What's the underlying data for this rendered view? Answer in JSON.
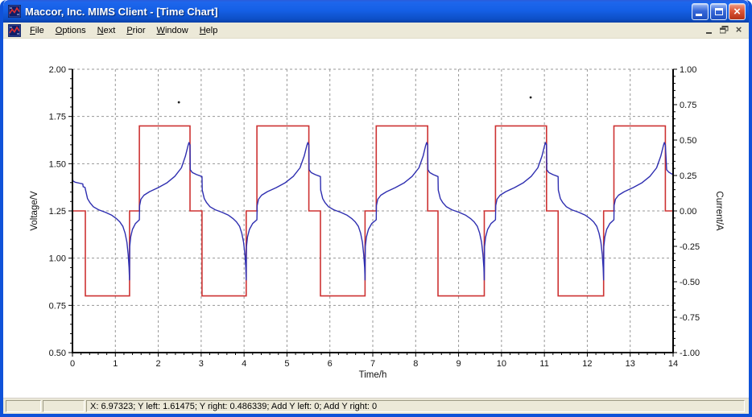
{
  "window": {
    "title": "Maccor, Inc. MIMS Client - [Time Chart]"
  },
  "menu": {
    "items": [
      {
        "label": "File",
        "underline": 0
      },
      {
        "label": "Options",
        "underline": 0
      },
      {
        "label": "Next",
        "underline": 0
      },
      {
        "label": "Prior",
        "underline": 0
      },
      {
        "label": "Window",
        "underline": 0
      },
      {
        "label": "Help",
        "underline": 0
      }
    ]
  },
  "status_bar": {
    "text": "X: 6.97323; Y left: 1.61475; Y right: 0.486339; Add Y left: 0; Add Y right: 0"
  },
  "chart_data": {
    "type": "line",
    "x_axis": {
      "label": "Time/h",
      "min": 0,
      "max": 14,
      "major_step": 1,
      "minor_step": 0.2
    },
    "y_left": {
      "label": "Voltage/V",
      "min": 0.5,
      "max": 2.0,
      "major_step": 0.25,
      "minor_step": 0.05
    },
    "y_right": {
      "label": "Current/A",
      "min": -1.0,
      "max": 1.0,
      "major_step": 0.25,
      "minor_step": 0.05
    },
    "grid": {
      "x_lines": [
        1,
        2,
        3,
        4,
        5,
        6,
        7,
        8,
        9,
        10,
        11,
        12,
        13
      ],
      "y_lines_left": [
        0.75,
        1.0,
        1.25,
        1.5,
        1.75,
        2.0
      ],
      "color": "#979797"
    },
    "series": [
      {
        "name": "Current",
        "axis": "right",
        "color": "#cd3232",
        "style": "step",
        "segments": [
          [
            0,
            0,
            0.6
          ],
          [
            0,
            0.3,
            0
          ],
          [
            0.3,
            1.33,
            -0.6
          ],
          [
            1.33,
            1.56,
            0
          ],
          [
            1.56,
            2.74,
            0.6
          ],
          [
            2.74,
            3.02,
            0
          ],
          [
            3.02,
            4.05,
            -0.6
          ],
          [
            4.05,
            4.3,
            0
          ],
          [
            4.3,
            5.51,
            0.6
          ],
          [
            5.51,
            5.78,
            0
          ],
          [
            5.78,
            6.82,
            -0.6
          ],
          [
            6.82,
            7.08,
            0
          ],
          [
            7.08,
            8.28,
            0.6
          ],
          [
            8.28,
            8.52,
            0
          ],
          [
            8.52,
            9.6,
            -0.6
          ],
          [
            9.6,
            9.86,
            0
          ],
          [
            9.86,
            11.05,
            0.6
          ],
          [
            11.05,
            11.32,
            0
          ],
          [
            11.32,
            12.38,
            -0.6
          ],
          [
            12.38,
            12.62,
            0
          ],
          [
            12.62,
            13.82,
            0.6
          ],
          [
            13.82,
            14,
            0
          ]
        ]
      },
      {
        "name": "Voltage",
        "axis": "left",
        "color": "#2e2eb0",
        "style": "curve",
        "initial_points": [
          [
            0,
            1.435
          ],
          [
            0.01,
            1.41
          ],
          [
            0.06,
            1.402
          ],
          [
            0.16,
            1.397
          ],
          [
            0.24,
            1.393
          ],
          [
            0.25,
            1.378
          ],
          [
            0.29,
            1.375
          ]
        ],
        "cycles": [
          {
            "d0": 0.3,
            "d1": 1.33,
            "c0": 1.56,
            "c1": 2.74
          },
          {
            "d0": 3.02,
            "d1": 4.05,
            "c0": 4.3,
            "c1": 5.51
          },
          {
            "d0": 5.78,
            "d1": 6.82,
            "c0": 7.08,
            "c1": 8.28
          },
          {
            "d0": 8.52,
            "d1": 9.6,
            "c0": 9.86,
            "c1": 11.05
          },
          {
            "d0": 11.32,
            "d1": 12.38,
            "c0": 12.62,
            "c1": 13.82
          }
        ],
        "discharge_shape": [
          [
            0.005,
            1.36
          ],
          [
            0.05,
            1.315
          ],
          [
            0.1,
            1.295
          ],
          [
            0.18,
            1.272
          ],
          [
            0.3,
            1.256
          ],
          [
            0.45,
            1.243
          ],
          [
            0.6,
            1.227
          ],
          [
            0.7,
            1.21
          ],
          [
            0.78,
            1.192
          ],
          [
            0.85,
            1.168
          ],
          [
            0.9,
            1.132
          ],
          [
            0.94,
            1.085
          ],
          [
            0.97,
            1.02
          ],
          [
            0.99,
            0.95
          ],
          [
            1,
            0.885
          ]
        ],
        "rest1_shape": [
          [
            0.02,
            1.06
          ],
          [
            0.12,
            1.112
          ],
          [
            0.3,
            1.152
          ],
          [
            0.6,
            1.183
          ],
          [
            1,
            1.203
          ]
        ],
        "charge_shape": [
          [
            0.004,
            1.278
          ],
          [
            0.03,
            1.312
          ],
          [
            0.09,
            1.333
          ],
          [
            0.2,
            1.352
          ],
          [
            0.37,
            1.373
          ],
          [
            0.54,
            1.398
          ],
          [
            0.7,
            1.433
          ],
          [
            0.83,
            1.478
          ],
          [
            0.91,
            1.54
          ],
          [
            0.96,
            1.595
          ],
          [
            0.98,
            1.612
          ],
          [
            1,
            1.6
          ]
        ],
        "rest2_shape": [
          [
            0.02,
            1.468
          ],
          [
            0.2,
            1.453
          ],
          [
            0.55,
            1.442
          ],
          [
            1,
            1.432
          ]
        ],
        "tail_points": [
          [
            13.85,
            1.468
          ],
          [
            13.9,
            1.455
          ],
          [
            13.96,
            1.447
          ],
          [
            14,
            1.443
          ]
        ]
      }
    ],
    "stray_points": [
      [
        2.48,
        1.825
      ],
      [
        10.68,
        1.851
      ]
    ]
  }
}
